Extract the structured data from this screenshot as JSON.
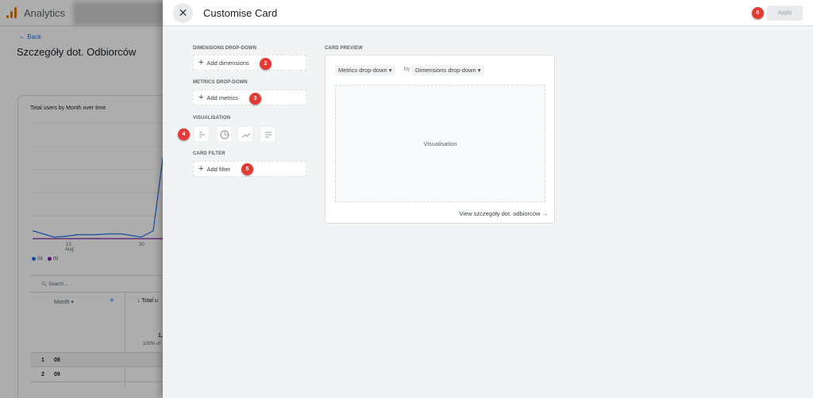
{
  "background": {
    "app_name": "Analytics",
    "back_label": "Back",
    "page_title": "Szczegóły dot. Odbiorców",
    "card_title": "Total users by Month over time",
    "x_ticks": [
      {
        "label": "13",
        "sub": "Aug"
      },
      {
        "label": "20",
        "sub": ""
      }
    ],
    "legend": [
      {
        "label": "08",
        "color": "#1a73e8"
      },
      {
        "label": "09",
        "color": "#7b1fa2"
      }
    ],
    "search_placeholder": "Search...",
    "table": {
      "col_month": "Month",
      "col_total": "Total u",
      "total_value": "1,",
      "total_pct": "100% of",
      "rows": [
        {
          "index": "1",
          "month": "08"
        },
        {
          "index": "2",
          "month": "09"
        }
      ]
    }
  },
  "panel": {
    "title": "Customise Card",
    "apply_label": "Apply",
    "sections": {
      "dimensions_label": "DIMENSIONS DROP-DOWN",
      "add_dimensions": "Add dimensions",
      "metrics_label": "METRICS DROP-DOWN",
      "add_metrics": "Add metrics",
      "visualisation_label": "VISUALISATION",
      "visualisation_options": [
        "bar-chart-icon",
        "donut-chart-icon",
        "line-chart-icon",
        "table-icon"
      ],
      "filter_label": "CARD FILTER",
      "add_filter": "Add filter"
    },
    "preview": {
      "label": "CARD PREVIEW",
      "metrics_dropdown": "Metrics drop-down",
      "by": "by",
      "dimensions_dropdown": "Dimensions drop-down",
      "visualisation_placeholder": "Visualisation",
      "view_link": "View szczegóły dot. odbiorców"
    },
    "badges": [
      "2",
      "3",
      "4",
      "5",
      "6"
    ]
  },
  "colors": {
    "badge": "#e53935",
    "accent": "#1a73e8",
    "panel_bg": "#f1f3f4"
  }
}
